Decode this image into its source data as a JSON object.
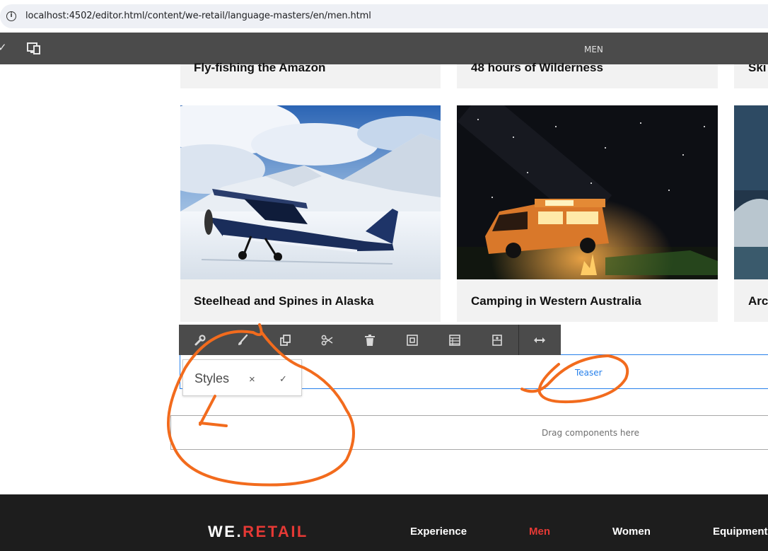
{
  "browser": {
    "url": "localhost:4502/editor.html/content/we-retail/language-masters/en/men.html"
  },
  "editor": {
    "page_title": "MEN"
  },
  "cards_top": [
    {
      "title": "Fly-fishing the Amazon"
    },
    {
      "title": "48 hours of Wilderness"
    },
    {
      "title": "Ski"
    }
  ],
  "cards": [
    {
      "title": "Steelhead and Spines in Alaska"
    },
    {
      "title": "Camping in Western Australia"
    },
    {
      "title": "Arc"
    }
  ],
  "component_toolbar": {
    "actions": [
      "configure",
      "styles",
      "copy",
      "cut",
      "delete",
      "group",
      "layout",
      "insert",
      "resize"
    ]
  },
  "teaser": {
    "label": "Teaser"
  },
  "styles_popover": {
    "label": "Styles",
    "close": "×",
    "confirm": "✓"
  },
  "dropzone": {
    "label": "Drag components here"
  },
  "footer": {
    "logo_we": "WE.",
    "logo_retail": "RETAIL",
    "nav": [
      "Experience",
      "Men",
      "Women",
      "Equipment"
    ],
    "active_nav": "Men"
  },
  "colors": {
    "annotation": "#f26b1d",
    "accent": "#e53935",
    "selection": "#2680eb"
  }
}
